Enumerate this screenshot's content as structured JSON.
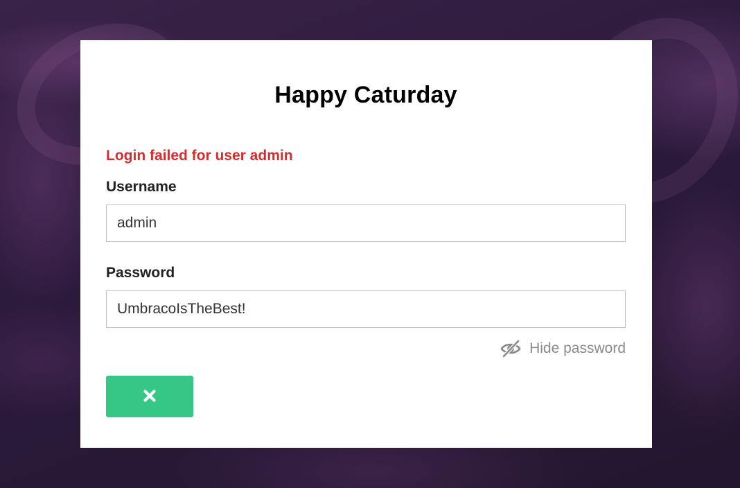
{
  "login": {
    "title": "Happy Caturday",
    "error_message": "Login failed for user admin",
    "username": {
      "label": "Username",
      "value": "admin"
    },
    "password": {
      "label": "Password",
      "value": "UmbracoIsTheBest!"
    },
    "toggle_password_label": "Hide password",
    "toggle_password_icon": "eye-slash-icon",
    "submit_icon": "close-icon"
  },
  "colors": {
    "error": "#d42e2e",
    "submit_button": "#35c786",
    "background": "#2b1a3b"
  }
}
